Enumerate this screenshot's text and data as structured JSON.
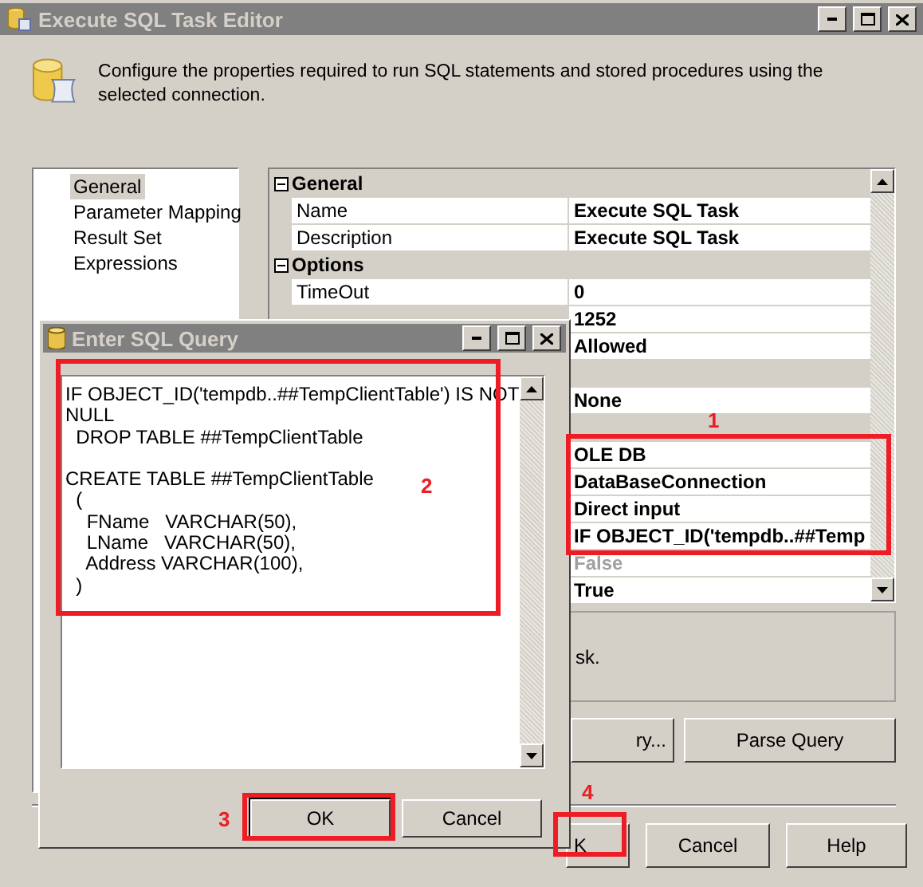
{
  "window": {
    "title": "Execute SQL Task Editor"
  },
  "header": {
    "description": "Configure the properties required to run SQL statements and stored procedures using the selected connection."
  },
  "sidebar": {
    "items": [
      {
        "label": "General",
        "selected": true
      },
      {
        "label": "Parameter Mapping",
        "selected": false
      },
      {
        "label": "Result Set",
        "selected": false
      },
      {
        "label": "Expressions",
        "selected": false
      }
    ]
  },
  "property_grid": {
    "rows": [
      {
        "kind": "category",
        "label": "General",
        "expanded": true
      },
      {
        "kind": "property",
        "name": "Name",
        "value": "Execute SQL Task",
        "disabled": false
      },
      {
        "kind": "property",
        "name": "Description",
        "value": "Execute SQL Task",
        "disabled": false
      },
      {
        "kind": "category",
        "label": "Options",
        "expanded": true
      },
      {
        "kind": "property",
        "name": "TimeOut",
        "value": "0",
        "disabled": false
      },
      {
        "kind": "property",
        "value": "1252",
        "disabled": false
      },
      {
        "kind": "property",
        "value": "Allowed",
        "disabled": false
      },
      {
        "kind": "category"
      },
      {
        "kind": "property",
        "value": "None",
        "disabled": false
      },
      {
        "kind": "category"
      },
      {
        "kind": "property",
        "value": "OLE DB",
        "disabled": false
      },
      {
        "kind": "property",
        "value": "DataBaseConnection",
        "disabled": false
      },
      {
        "kind": "property",
        "value": "Direct input",
        "disabled": false
      },
      {
        "kind": "property",
        "value": "IF OBJECT_ID('tempdb..##Temp",
        "disabled": false
      },
      {
        "kind": "property",
        "value": "False",
        "disabled": true
      },
      {
        "kind": "property",
        "value": "True",
        "disabled": false
      }
    ]
  },
  "description_panel": {
    "text": "sk."
  },
  "query_buttons": [
    "ry...",
    "Parse Query"
  ],
  "dialog_buttons": [
    "K",
    "Cancel",
    "Help"
  ],
  "sql_dialog": {
    "title": "Enter SQL Query",
    "query": "IF OBJECT_ID('tempdb..##TempClientTable') IS NOT\nNULL\n  DROP TABLE ##TempClientTable\n\nCREATE TABLE ##TempClientTable\n  (\n    FName   VARCHAR(50),\n    LName   VARCHAR(50),\n    Address VARCHAR(100),\n  )",
    "buttons": [
      "OK",
      "Cancel"
    ]
  },
  "annotations": [
    {
      "label": "1"
    },
    {
      "label": "2"
    },
    {
      "label": "3"
    },
    {
      "label": "4"
    }
  ]
}
